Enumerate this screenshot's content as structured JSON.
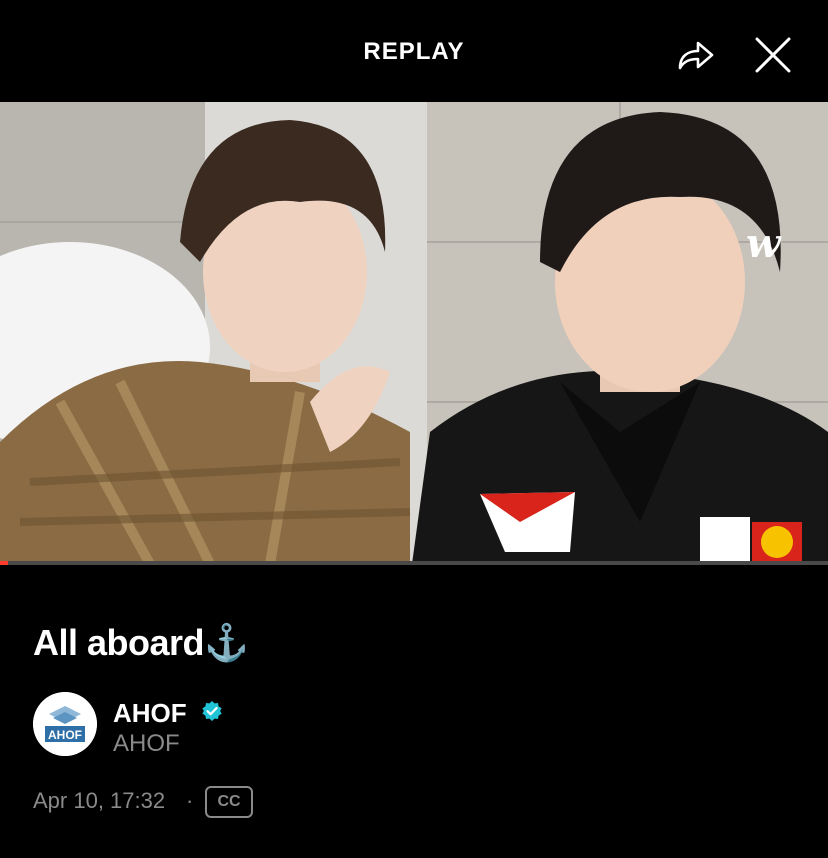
{
  "header": {
    "title": "REPLAY"
  },
  "icons": {
    "share": "share-arrow-icon",
    "close": "close-x-icon",
    "verified": "verified-badge-icon",
    "watermark": "weverse-logo"
  },
  "video": {
    "watermark_text": "w",
    "progress_fraction": 0.01
  },
  "post": {
    "title": "All aboard⚓",
    "channel_name": "AHOF",
    "channel_handle": "AHOF",
    "avatar_text": "AHOF",
    "date": "Apr 10, 17:32",
    "separator": "·",
    "cc_label": "CC"
  },
  "colors": {
    "background": "#000000",
    "verified": "#20c4d6",
    "progress": "#ff3b30"
  }
}
